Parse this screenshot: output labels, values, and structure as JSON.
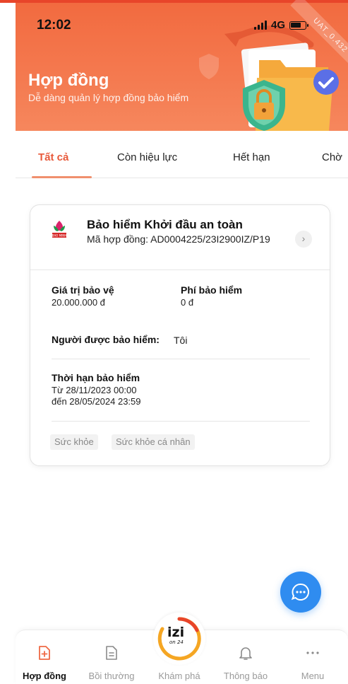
{
  "status_bar": {
    "time": "12:02",
    "network": "4G",
    "version_ribbon": "UAT_0.432"
  },
  "header": {
    "title": "Hợp đồng",
    "subtitle": "Dễ dàng quản lý hợp đồng bảo hiểm"
  },
  "tabs": [
    {
      "label": "Tất cả",
      "active": true
    },
    {
      "label": "Còn hiệu lực",
      "active": false
    },
    {
      "label": "Hết hạn",
      "active": false
    },
    {
      "label": "Chờ",
      "active": false
    }
  ],
  "contract_card": {
    "insurer_logo_text": "BAO MINH",
    "product_name": "Bảo hiểm Khởi đầu an toàn",
    "contract_number": "Mã hợp đồng: AD0004225/23I2900IZ/P19",
    "coverage_label": "Giá trị bảo vệ",
    "coverage_value": "20.000.000 đ",
    "premium_label": "Phí bảo hiểm",
    "premium_value": "0 đ",
    "insured_label": "Người được bảo hiểm:",
    "insured_value": "Tôi",
    "period_label": "Thời hạn bảo hiểm",
    "period_from": "Từ 28/11/2023 00:00",
    "period_to": "đến 28/05/2024 23:59",
    "tags": [
      "Sức khỏe",
      "Sức khỏe cá nhân"
    ]
  },
  "bottom_nav": {
    "items": [
      {
        "label": "Hợp đồng",
        "icon": "contract-plus-icon",
        "active": true
      },
      {
        "label": "Bồi thường",
        "icon": "claim-document-icon",
        "active": false
      },
      {
        "label": "Khám phá",
        "icon": "izi-logo",
        "active": false
      },
      {
        "label": "Thông báo",
        "icon": "bell-icon",
        "active": false
      },
      {
        "label": "Menu",
        "icon": "more-dots-icon",
        "active": false
      }
    ],
    "izi_logo_text": "izi",
    "izi_logo_subtext": "on 24"
  },
  "colors": {
    "header_orange": "#f26a3f",
    "active_tab": "#e8593a",
    "fab_blue": "#2f8cf0",
    "izi_ring": "#f5a623"
  }
}
